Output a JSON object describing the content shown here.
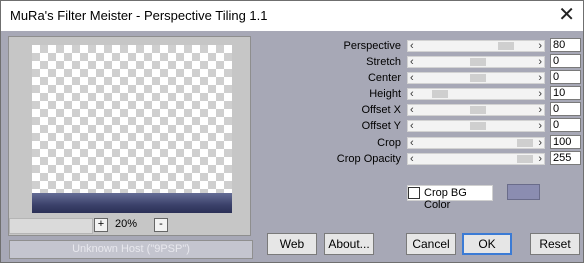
{
  "window": {
    "title": "MuRa's Filter Meister - Perspective Tiling 1.1",
    "close_glyph": "✕"
  },
  "zoom": {
    "value": "20%",
    "plus": "+",
    "minus": "-"
  },
  "status": "Unknown Host (\"9PSP\")",
  "sliders": [
    {
      "label": "Perspective",
      "value": "80",
      "level": 0.78
    },
    {
      "label": "Stretch",
      "value": "0",
      "level": 0.5
    },
    {
      "label": "Center",
      "value": "0",
      "level": 0.5
    },
    {
      "label": "Height",
      "value": "10",
      "level": 0.12
    },
    {
      "label": "Offset X",
      "value": "0",
      "level": 0.5
    },
    {
      "label": "Offset Y",
      "value": "0",
      "level": 0.5
    },
    {
      "label": "Crop",
      "value": "100",
      "level": 0.97
    },
    {
      "label": "Crop Opacity",
      "value": "255",
      "level": 0.97
    }
  ],
  "crop_bg": {
    "label": "Crop BG Color",
    "checked": false,
    "color": "#8b8db1"
  },
  "buttons": {
    "web": "Web",
    "about": "About...",
    "cancel": "Cancel",
    "ok": "OK",
    "reset": "Reset"
  },
  "arrows": {
    "left": "‹",
    "right": "›"
  }
}
